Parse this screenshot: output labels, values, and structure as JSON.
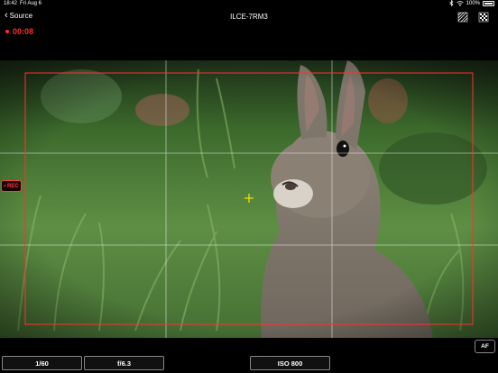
{
  "status_bar": {
    "time": "18:42",
    "date": "Fri Aug 6",
    "battery": "100%"
  },
  "nav": {
    "back_label": "Source",
    "title": "ILCE-7RM3",
    "icons": [
      "zebra-stripes-icon",
      "focus-peaking-icon"
    ]
  },
  "recording": {
    "elapsed": "00:08",
    "badge_label": "• REC",
    "color": "#ff2d2d"
  },
  "controls": {
    "af_label": "AF",
    "shutter": "1/60",
    "aperture": "f/6.3",
    "iso": "ISO 800"
  },
  "colors": {
    "frame_line": "#ff3030",
    "grid_line": "#ffffff",
    "focus_point": "#ffe000"
  }
}
